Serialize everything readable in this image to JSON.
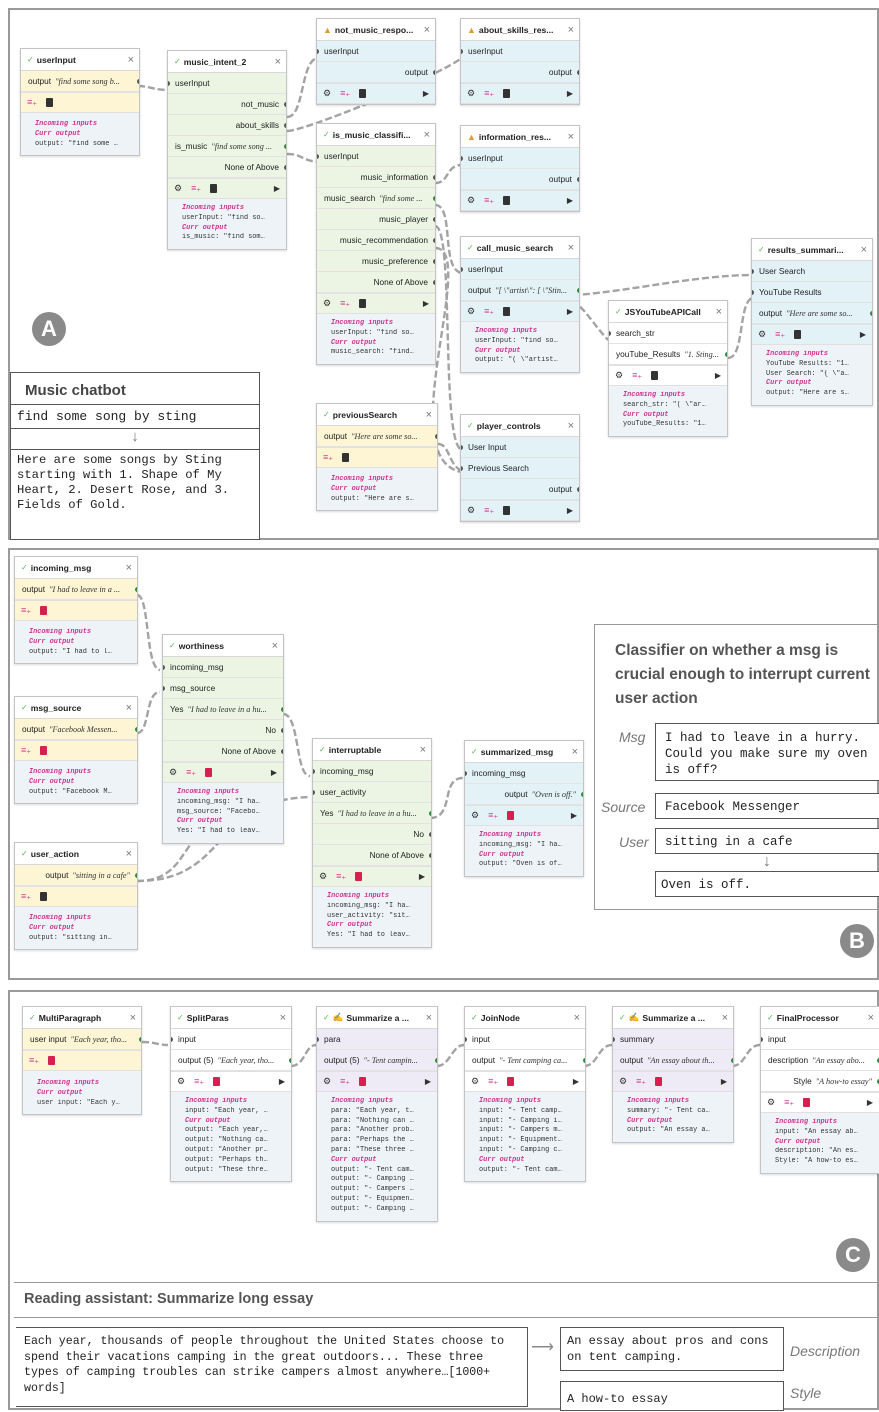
{
  "panel_a": {
    "badge": "A",
    "nodes": {
      "userInput": {
        "title": "userInput",
        "output_label": "output",
        "output_value": "\"find some song b...",
        "info": [
          "Incoming inputs",
          "Curr output",
          "output: \"find some …"
        ]
      },
      "music_intent_2": {
        "title": "music_intent_2",
        "input": "userInput",
        "rows": [
          "not_music",
          "about_skills"
        ],
        "is_music_label": "is_music",
        "is_music_value": "\"find some song ...",
        "none": "None of Above",
        "info": [
          "Incoming inputs",
          "userInput: \"find so…",
          "Curr output",
          "is_music: \"find som…"
        ]
      },
      "not_music_response": {
        "title": "not_music_respo...",
        "input": "userInput",
        "output": "output"
      },
      "about_skills_response": {
        "title": "about_skills_res...",
        "input": "userInput",
        "output": "output"
      },
      "is_music_classifier": {
        "title": "is_music_classifi...",
        "input": "userInput",
        "rows": [
          "music_information"
        ],
        "search_label": "music_search",
        "search_value": "\"find some ...",
        "rows2": [
          "music_player",
          "music_recommendation",
          "music_preference",
          "None of Above"
        ],
        "info": [
          "Incoming inputs",
          "userInput: \"find so…",
          "Curr output",
          "music_search: \"find…"
        ]
      },
      "information_response": {
        "title": "information_res...",
        "input": "userInput",
        "output": "output"
      },
      "call_music_search": {
        "title": "call_music_search",
        "input": "userInput",
        "output_label": "output",
        "output_value": "\"[ \\\"artist\\\": [ \\\"Stin...",
        "info": [
          "Incoming inputs",
          "userInput: \"find so…",
          "Curr output",
          "output: \"( \\\"artist…"
        ]
      },
      "JSYouTubeAPICall": {
        "title": "JSYouTubeAPICall",
        "input": "search_str",
        "output_label": "youTube_Results",
        "output_value": "\"1. Sting...",
        "info": [
          "Incoming inputs",
          "search_str: \"( \\\"ar…",
          "Curr output",
          "youTube_Results: \"1…"
        ]
      },
      "results_summarizer": {
        "title": "results_summari...",
        "inputs": [
          "User Search",
          "YouTube Results"
        ],
        "output_label": "output",
        "output_value": "\"Here are some so...",
        "info": [
          "Incoming inputs",
          "YouTube Results: \"1…",
          "User Search: \"{ \\\"a…",
          "Curr output",
          "output: \"Here are s…"
        ]
      },
      "previousSearch": {
        "title": "previousSearch",
        "output_label": "output",
        "output_value": "\"Here are some so...",
        "info": [
          "Incoming inputs",
          "Curr output",
          "output: \"Here are s…"
        ]
      },
      "player_controls": {
        "title": "player_controls",
        "inputs": [
          "User Input",
          "Previous Search"
        ],
        "output": "output"
      }
    },
    "chat": {
      "title": "Music chatbot",
      "query": "find some song by sting",
      "response": "Here are some songs by Sting starting with 1. Shape of My Heart, 2. Desert Rose, and 3. Fields of Gold."
    }
  },
  "panel_b": {
    "badge": "B",
    "nodes": {
      "incoming_msg": {
        "title": "incoming_msg",
        "output_label": "output",
        "output_value": "\"I had to leave in a ...",
        "info": [
          "Incoming inputs",
          "Curr output",
          "output: \"I had to l…"
        ]
      },
      "msg_source": {
        "title": "msg_source",
        "output_label": "output",
        "output_value": "\"Facebook Messen...",
        "info": [
          "Incoming inputs",
          "Curr output",
          "output: \"Facebook M…"
        ]
      },
      "user_action": {
        "title": "user_action",
        "output_label": "output",
        "output_value": "\"sitting in a cafe\"",
        "info": [
          "Incoming inputs",
          "Curr output",
          "output: \"sitting in…"
        ]
      },
      "worthiness": {
        "title": "worthiness",
        "inputs": [
          "incoming_msg",
          "msg_source"
        ],
        "yes_label": "Yes",
        "yes_value": "\"I had to leave in a hu...",
        "rows": [
          "No",
          "None of Above"
        ],
        "info": [
          "Incoming inputs",
          "incoming_msg: \"I ha…",
          "msg_source: \"Facebo…",
          "Curr output",
          "Yes: \"I had to leav…"
        ]
      },
      "interruptable": {
        "title": "interruptable",
        "inputs": [
          "incoming_msg",
          "user_activity"
        ],
        "yes_label": "Yes",
        "yes_value": "\"I had to leave in a hu...",
        "rows": [
          "No",
          "None of Above"
        ],
        "info": [
          "Incoming inputs",
          "incoming_msg: \"I ha…",
          "user_activity: \"sit…",
          "Curr output",
          "Yes: \"I had to leav…"
        ]
      },
      "summarized_msg": {
        "title": "summarized_msg",
        "input": "incoming_msg",
        "output_label": "output",
        "output_value": "\"Oven is off.\"",
        "info": [
          "Incoming inputs",
          "incoming_msg: \"I ha…",
          "Curr output",
          "output: \"Oven is of…"
        ]
      }
    },
    "classifier": {
      "title": "Classifier on whether a msg is crucial enough to interrupt current user action",
      "msg_label": "Msg",
      "msg": "I had to leave in a hurry. Could you make sure my oven is off?",
      "source_label": "Source",
      "source": "Facebook Messenger",
      "user_label": "User",
      "user": "sitting in a cafe",
      "result": "Oven is off."
    }
  },
  "panel_c": {
    "badge": "C",
    "nodes": {
      "MultiParagraph": {
        "title": "MultiParagraph",
        "output_label": "user input",
        "output_value": "\"Each year, tho...",
        "info": [
          "Incoming inputs",
          "Curr output",
          "user input: \"Each y…"
        ]
      },
      "SplitParas": {
        "title": "SplitParas",
        "input": "input",
        "output_label": "output (5)",
        "output_value": "\"Each year, tho...",
        "info": [
          "Incoming inputs",
          "input: \"Each year, …",
          "Curr output",
          "output: \"Each year,…",
          "output: \"Nothing ca…",
          "output: \"Another pr…",
          "output: \"Perhaps th…",
          "output: \"These thre…"
        ]
      },
      "Summarize1": {
        "title": "Summarize a ...",
        "input": "para",
        "output_label": "output (5)",
        "output_value": "\"- Tent campin...",
        "info": [
          "Incoming inputs",
          "para: \"Each year, t…",
          "para: \"Nothing can …",
          "para: \"Another prob…",
          "para: \"Perhaps the …",
          "para: \"These three …",
          "Curr output",
          "output: \"- Tent cam…",
          "output: \"- Camping …",
          "output: \"- Campers …",
          "output: \"- Equipmen…",
          "output: \"- Camping …"
        ]
      },
      "JoinNode": {
        "title": "JoinNode",
        "input": "input",
        "output_label": "output",
        "output_value": "\"- Tent camping ca...",
        "info": [
          "Incoming inputs",
          "input: \"- Tent camp…",
          "input: \"- Camping i…",
          "input: \"- Campers m…",
          "input: \"- Equipment…",
          "input: \"- Camping c…",
          "Curr output",
          "output: \"- Tent cam…"
        ]
      },
      "Summarize2": {
        "title": "Summarize a ...",
        "input": "summary",
        "output_label": "output",
        "output_value": "\"An essay about th...",
        "info": [
          "Incoming inputs",
          "summary: \"- Tent ca…",
          "Curr output",
          "output: \"An essay a…"
        ]
      },
      "FinalProcessor": {
        "title": "FinalProcessor",
        "input": "input",
        "desc_label": "description",
        "desc_value": "\"An essay abo...",
        "style_label": "Style",
        "style_value": "\"A how-to essay\"",
        "info": [
          "Incoming inputs",
          "input: \"An essay ab…",
          "Curr output",
          "description: \"An es…",
          "Style: \"A how-to es…"
        ]
      }
    },
    "assistant": {
      "title": "Reading assistant: Summarize long essay",
      "essay": "Each year, thousands of people throughout the United States choose to spend their vacations camping in the great outdoors... These three types of camping troubles can strike campers almost anywhere…[1000+ words]",
      "description": "An essay about pros and cons on tent camping.",
      "description_label": "Description",
      "style": "A how-to essay",
      "style_label": "Style"
    }
  },
  "colors": {
    "yellow": "#fdf5d3",
    "green": "#ecf5e3",
    "blue": "#e3f2f7",
    "purple": "#eeeaf6",
    "pink": "#d03090",
    "warn": "#e59a2d"
  }
}
